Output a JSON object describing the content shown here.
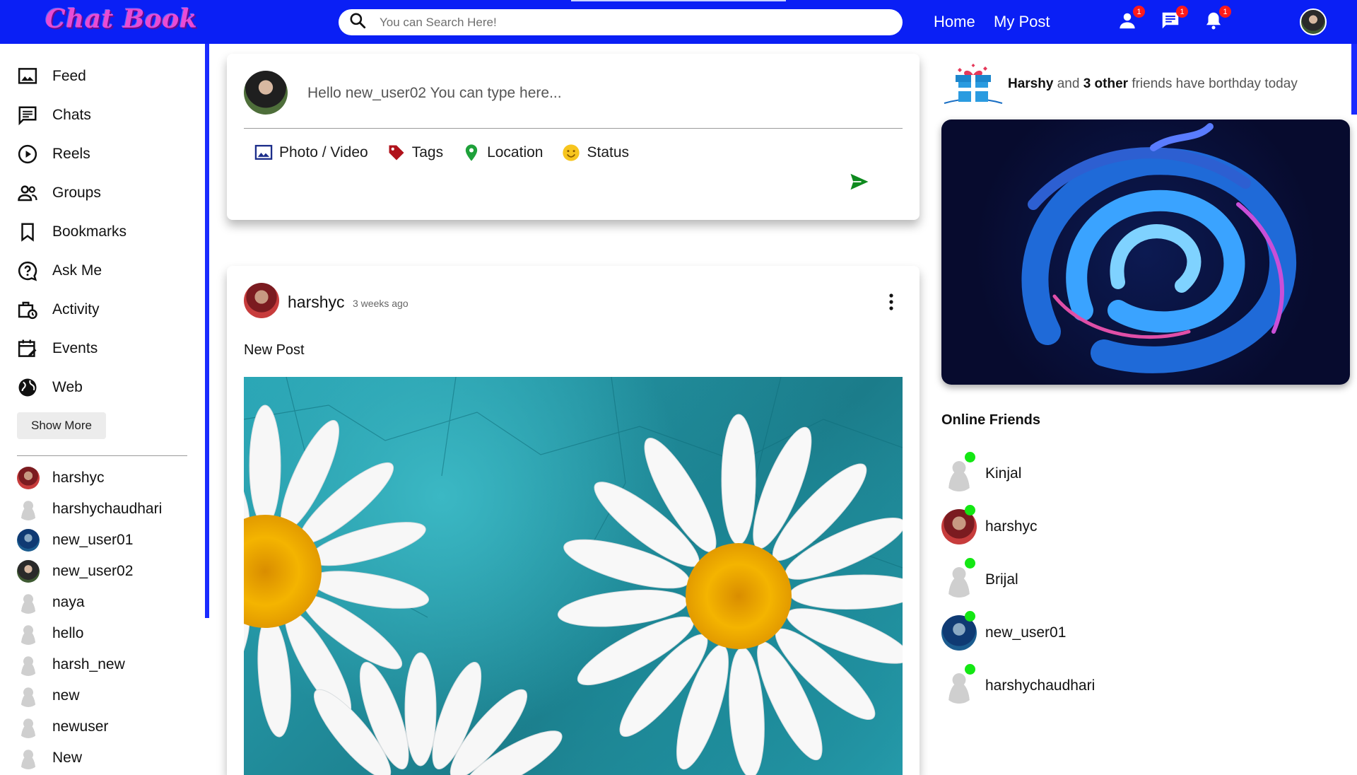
{
  "app": {
    "logo_text": "Chat Book"
  },
  "search": {
    "placeholder": "You can Search Here!"
  },
  "nav": {
    "home": "Home",
    "my_post": "My Post"
  },
  "topbar_badges": {
    "friends": "1",
    "messages": "1",
    "notifications": "1"
  },
  "sidebar": {
    "menu": [
      {
        "label": "Feed",
        "icon": "feed-icon"
      },
      {
        "label": "Chats",
        "icon": "chats-icon"
      },
      {
        "label": "Reels",
        "icon": "reels-icon"
      },
      {
        "label": "Groups",
        "icon": "groups-icon"
      },
      {
        "label": "Bookmarks",
        "icon": "bookmark-icon"
      },
      {
        "label": "Ask Me",
        "icon": "help-icon"
      },
      {
        "label": "Activity",
        "icon": "activity-icon"
      },
      {
        "label": "Events",
        "icon": "events-icon"
      },
      {
        "label": "Web",
        "icon": "globe-icon"
      }
    ],
    "show_more": "Show More",
    "friends": [
      "harshyc",
      "harshychaudhari",
      "new_user01",
      "new_user02",
      "naya",
      "hello",
      "harsh_new",
      "new",
      "newuser",
      "New"
    ]
  },
  "share": {
    "prompt": "Hello new_user02 You can type here...",
    "options": {
      "photo": "Photo / Video",
      "tags": "Tags",
      "location": "Location",
      "status": "Status"
    }
  },
  "post": {
    "username": "harshyc",
    "time": "3 weeks ago",
    "caption": "New Post"
  },
  "birthday": {
    "name": "Harshy",
    "and": "and",
    "count": "3 other",
    "rest": "friends have borthday today"
  },
  "online": {
    "title": "Online Friends",
    "friends": [
      "Kinjal",
      "harshyc",
      "Brijal",
      "new_user01",
      "harshychaudhari"
    ]
  },
  "colors": {
    "topbar": "#0a1ff5",
    "logo": "#e84bd6",
    "online_dot": "#13e713",
    "badge": "#ff1a1a"
  }
}
